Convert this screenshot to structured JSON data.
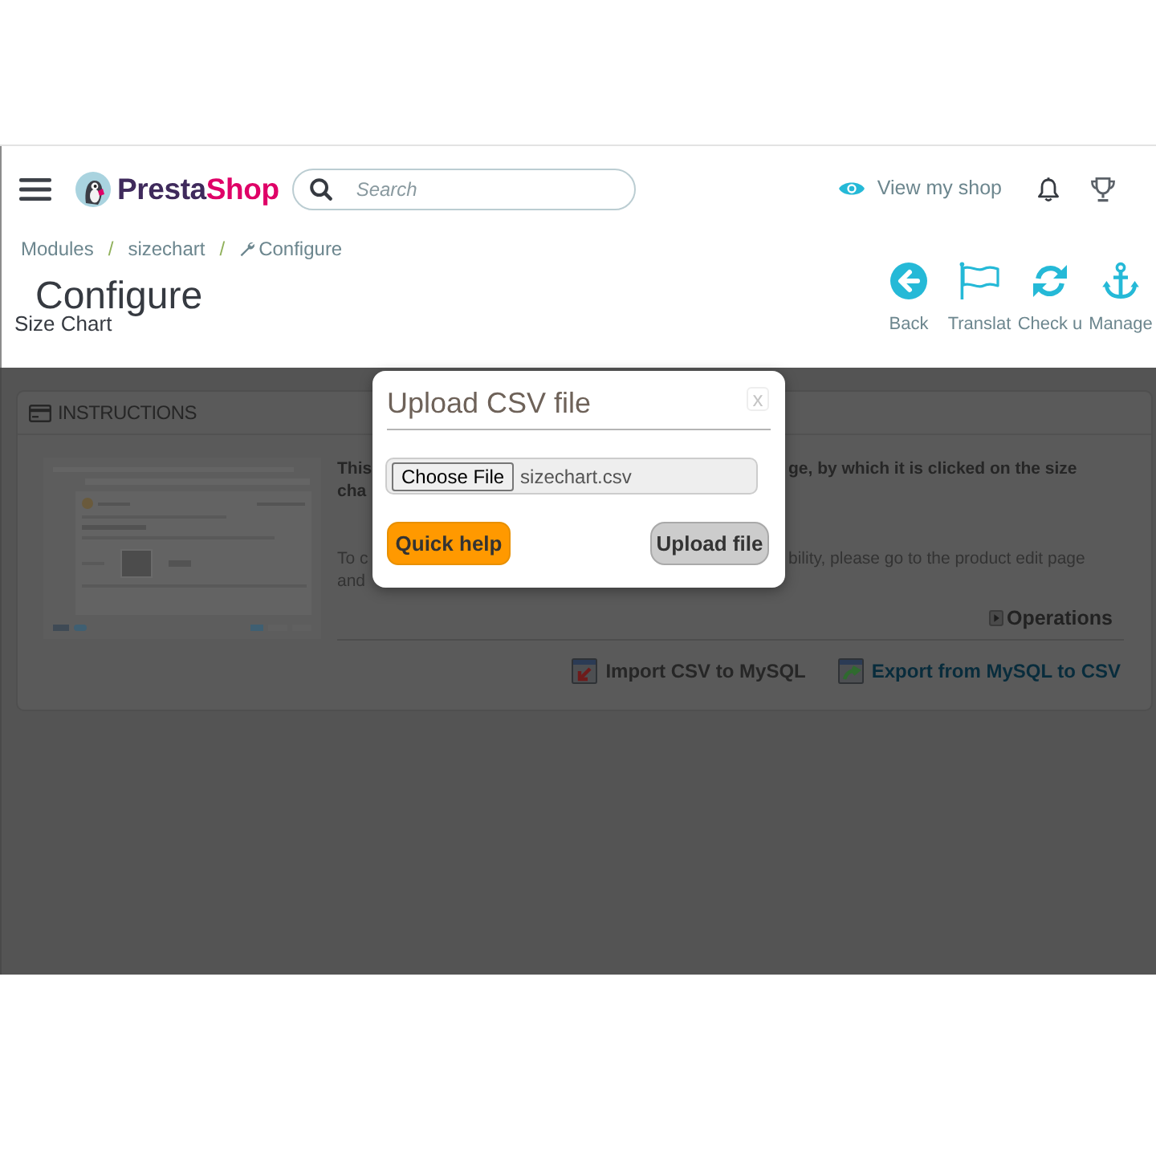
{
  "header": {
    "logo": {
      "first": "Presta",
      "second": "Shop"
    },
    "search": {
      "placeholder": "Search"
    },
    "view_shop": "View my shop"
  },
  "breadcrumb": [
    {
      "kind": "link",
      "label": "Modules"
    },
    {
      "kind": "separator",
      "label": "/"
    },
    {
      "kind": "link",
      "label": "sizechart"
    },
    {
      "kind": "separator",
      "label": "/"
    },
    {
      "kind": "current",
      "label": "Configure"
    }
  ],
  "page": {
    "title": "Configure",
    "subtitle": "Size Chart"
  },
  "toolbar": [
    {
      "kind": "back",
      "label": "Back"
    },
    {
      "kind": "translate",
      "label": "Translat"
    },
    {
      "kind": "refresh",
      "label": "Check u"
    },
    {
      "kind": "manage",
      "label": "Manage"
    }
  ],
  "instructions": {
    "title": "INSTRUCTIONS",
    "paragraphs": [
      {
        "bold": true,
        "lines": [
          {
            "left": "This",
            "right": "ge, by which it is clicked on the size"
          },
          {
            "left": "cha"
          }
        ]
      },
      {
        "bold": false,
        "lines": [
          {
            "left": "To c",
            "right": "bility, please go to the product edit page"
          },
          {
            "left": "and"
          }
        ]
      }
    ],
    "operations": "Operations",
    "actions": [
      {
        "kind": "import",
        "label": "Import CSV to MySQL"
      },
      {
        "kind": "export",
        "label": "Export from MySQL to CSV"
      }
    ]
  },
  "dialog": {
    "title": "Upload CSV file",
    "close": "x",
    "file_input": {
      "button": "Choose File",
      "value": "sizechart.csv"
    },
    "buttons": [
      {
        "kind": "help",
        "label": "Quick help"
      },
      {
        "kind": "upload",
        "label": "Upload file"
      }
    ]
  }
}
